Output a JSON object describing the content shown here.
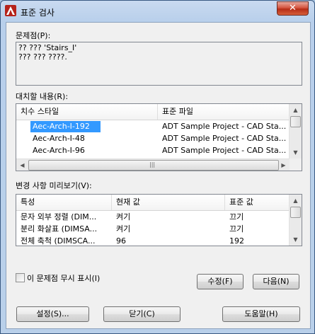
{
  "window": {
    "title": "표준 검사",
    "close_glyph": "✕"
  },
  "problem": {
    "label": "문제점(P):",
    "lines": [
      "?? ??? 'Stairs_I'",
      "??? ??? ????."
    ]
  },
  "replace": {
    "label": "대치할 내용(R):",
    "columns": [
      "치수 스타일",
      "표준 파일"
    ],
    "rows": [
      {
        "name": "Aec-Arch-I-192",
        "file": "ADT Sample Project - CAD Sta...",
        "selected": true
      },
      {
        "name": "Aec-Arch-I-48",
        "file": "ADT Sample Project - CAD Sta..."
      },
      {
        "name": "Aec-Arch-I-96",
        "file": "ADT Sample Project - CAD Sta..."
      }
    ]
  },
  "preview": {
    "label": "변경 사항 미리보기(V):",
    "columns": [
      "특성",
      "현재 값",
      "표준 값"
    ],
    "rows": [
      {
        "prop": "문자 외부 정렬 (DIM...",
        "current": "켜기",
        "standard": "끄기"
      },
      {
        "prop": "분리 화살표 (DIMSA...",
        "current": "켜기",
        "standard": "끄기"
      },
      {
        "prop": "전체 축척 (DIMSCA...",
        "current": "96",
        "standard": "192"
      }
    ]
  },
  "ignore_checkbox": {
    "label": "이 문제점 무시 표시(I)",
    "checked": false
  },
  "buttons": {
    "fix": "수정(F)",
    "next": "다음(N)",
    "settings": "설정(S)...",
    "close": "닫기(C)",
    "help": "도움말(H)"
  },
  "scroll_glyphs": {
    "up": "▲",
    "down": "▼",
    "left": "◀",
    "right": "▶",
    "grip_v": "≡",
    "grip_h": "|||"
  }
}
